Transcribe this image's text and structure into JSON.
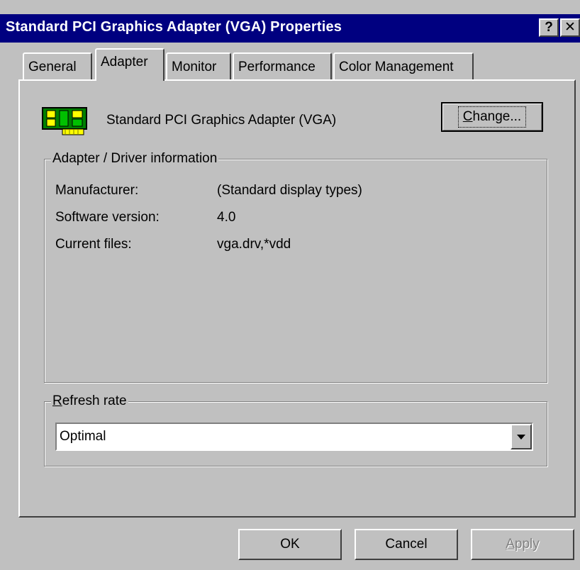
{
  "window": {
    "title": "Standard PCI Graphics Adapter (VGA) Properties",
    "help_glyph": "?",
    "close_glyph": "✕"
  },
  "tabs": [
    {
      "label": "General",
      "active": false
    },
    {
      "label": "Adapter",
      "active": true
    },
    {
      "label": "Monitor",
      "active": false
    },
    {
      "label": "Performance",
      "active": false
    },
    {
      "label": "Color Management",
      "active": false
    }
  ],
  "adapter": {
    "icon": "graphics-card-icon",
    "name": "Standard PCI Graphics Adapter (VGA)",
    "change_button": {
      "mnemonic": "C",
      "rest": "hange..."
    }
  },
  "driver_info": {
    "legend": "Adapter / Driver information",
    "rows": [
      {
        "label": "Manufacturer:",
        "value": "(Standard display types)"
      },
      {
        "label": "Software version:",
        "value": "4.0"
      },
      {
        "label": "Current files:",
        "value": "vga.drv,*vdd"
      }
    ]
  },
  "refresh_rate": {
    "legend_mnemonic": "R",
    "legend_rest": "efresh rate",
    "selected": "Optimal"
  },
  "footer": {
    "ok_label": "OK",
    "cancel_label": "Cancel",
    "apply_mnemonic": "A",
    "apply_rest": "pply"
  },
  "colors": {
    "titlebar": "#000080",
    "face": "#c0c0c0",
    "shadow": "#808080",
    "highlight": "#ffffff"
  }
}
